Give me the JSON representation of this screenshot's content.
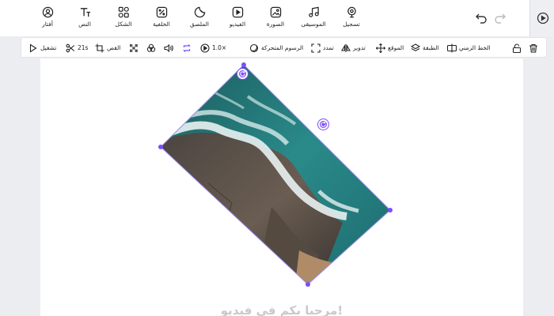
{
  "top_toolbar": {
    "items": [
      {
        "label": "أفتار",
        "icon": "avatar-icon"
      },
      {
        "label": "النص",
        "icon": "text-icon"
      },
      {
        "label": "الشكل",
        "icon": "shapes-icon"
      },
      {
        "label": "الخلفية",
        "icon": "background-icon"
      },
      {
        "label": "الملصق",
        "icon": "sticker-icon"
      },
      {
        "label": "الفيديو",
        "icon": "video-icon"
      },
      {
        "label": "الصورة",
        "icon": "image-icon"
      },
      {
        "label": "الموسيقى",
        "icon": "music-icon"
      },
      {
        "label": "تسجيل",
        "icon": "record-icon"
      }
    ]
  },
  "toolbar": {
    "play_label": "تشغيل",
    "duration_label": "21s",
    "crop_label": "القص",
    "speed_label": "1.0×",
    "animation_label": "الرسوم المتحركة",
    "stretch_label": "تمدد",
    "rotate_label": "تدوير",
    "position_label": "الموقع",
    "layer_label": "الطبقة",
    "timeline_label": "الخط الزمني"
  },
  "canvas": {
    "caption": "مرحبا بكم في فيديو!"
  },
  "colors": {
    "accent": "#7c4dff",
    "workspace": "#ecedf0",
    "canvas": "#ffffff"
  }
}
